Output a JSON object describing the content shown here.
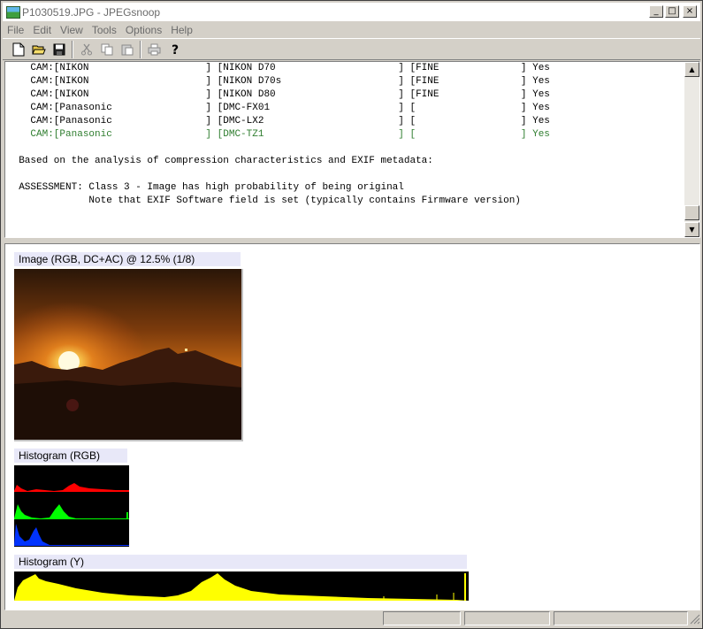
{
  "window": {
    "title": "P1030519.JPG - JPEGsnoop",
    "controls": {
      "minimize": "_",
      "maximize": "□",
      "close": "×"
    }
  },
  "menu": [
    {
      "label": "File"
    },
    {
      "label": "Edit"
    },
    {
      "label": "View"
    },
    {
      "label": "Tools"
    },
    {
      "label": "Options"
    },
    {
      "label": "Help"
    }
  ],
  "toolbar": {
    "new_icon": "new-file-icon",
    "open_icon": "open-folder-icon",
    "save_icon": "save-disk-icon",
    "cut_icon": "cut-icon",
    "copy_icon": "copy-icon",
    "paste_icon": "paste-icon",
    "print_icon": "print-icon",
    "help_icon": "help-icon"
  },
  "report": {
    "lines": [
      "    CAM:[NIKON                    ] [NIKON D70                     ] [FINE              ] Yes",
      "    CAM:[NIKON                    ] [NIKON D70s                    ] [FINE              ] Yes",
      "    CAM:[NIKON                    ] [NIKON D80                     ] [FINE              ] Yes",
      "    CAM:[Panasonic                ] [DMC-FX01                      ] [                  ] Yes",
      "    CAM:[Panasonic                ] [DMC-LX2                       ] [                  ] Yes",
      "    CAM:[Panasonic                ] [DMC-TZ1                       ] [                  ] Yes",
      "",
      "  Based on the analysis of compression characteristics and EXIF metadata:",
      "",
      "  ASSESSMENT: Class 3 - Image has high probability of being original",
      "              Note that EXIF Software field is set (typically contains Firmware version)"
    ],
    "highlight_color": "#2e7d2e"
  },
  "image_panel": {
    "image_caption": "Image (RGB, DC+AC) @ 12.5% (1/8)",
    "hist_rgb_caption": "Histogram (RGB)",
    "hist_y_caption": "Histogram (Y)"
  }
}
